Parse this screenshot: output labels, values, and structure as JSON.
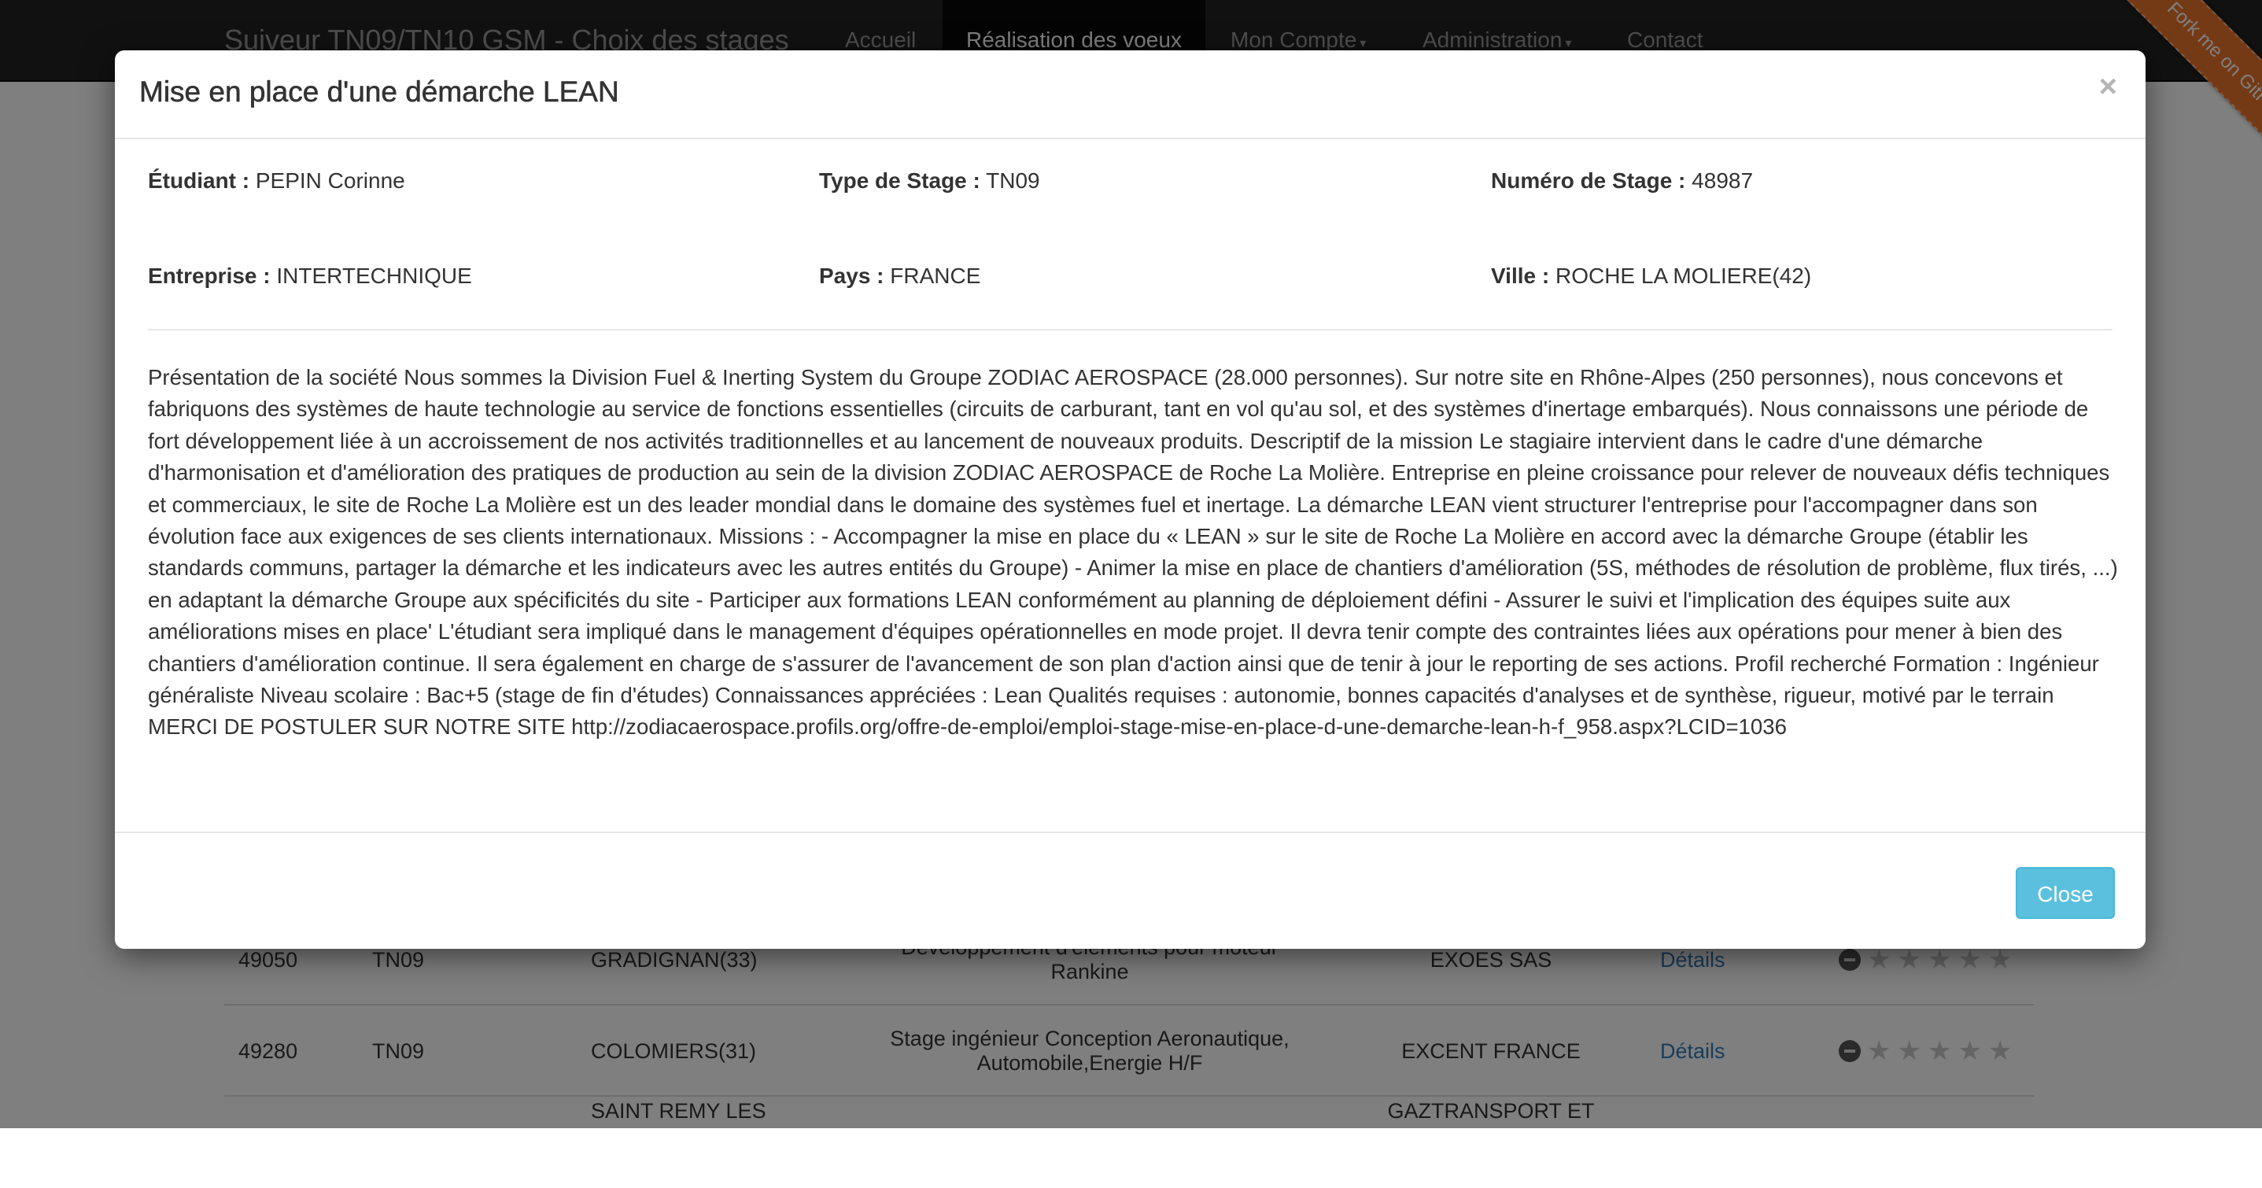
{
  "navbar": {
    "brand": "Suiveur TN09/TN10 GSM - Choix des stages",
    "items": [
      {
        "label": "Accueil"
      },
      {
        "label": "Réalisation des voeux"
      },
      {
        "label": "Mon Compte"
      },
      {
        "label": "Administration"
      },
      {
        "label": "Contact"
      }
    ],
    "ribbon": "Fork me on GitHub"
  },
  "table": {
    "rows": [
      {
        "number": "49050",
        "type": "TN09",
        "city": "GRADIGNAN(33)",
        "title": "Développement d'éléments pour moteur Rankine",
        "company": "EXOES SAS",
        "link": "Détails"
      },
      {
        "number": "49280",
        "type": "TN09",
        "city": "COLOMIERS(31)",
        "title": "Stage ingénieur Conception Aeronautique, Automobile,Energie H/F",
        "company": "EXCENT FRANCE",
        "link": "Détails"
      },
      {
        "number": "",
        "type": "",
        "city": "SAINT REMY LES",
        "title": "",
        "company": "GAZTRANSPORT ET",
        "link": ""
      }
    ]
  },
  "modal": {
    "title": "Mise en place d'une démarche LEAN",
    "close_symbol": "×",
    "fields": {
      "student": {
        "label": "Étudiant :",
        "value": "PEPIN Corinne"
      },
      "type": {
        "label": "Type de Stage :",
        "value": "TN09"
      },
      "number": {
        "label": "Numéro de Stage :",
        "value": "48987"
      },
      "company": {
        "label": "Entreprise :",
        "value": "INTERTECHNIQUE"
      },
      "country": {
        "label": "Pays :",
        "value": "FRANCE"
      },
      "city": {
        "label": "Ville :",
        "value": "ROCHE LA MOLIERE(42)"
      }
    },
    "description": "Présentation de la société Nous sommes la Division Fuel & Inerting System du Groupe ZODIAC AEROSPACE (28.000 personnes). Sur notre site en Rhône-Alpes (250 personnes), nous concevons et fabriquons des systèmes de haute technologie au service de fonctions essentielles (circuits de carburant, tant en vol qu'au sol, et des systèmes d'inertage embarqués). Nous connaissons une période de fort développement liée à un accroissement de nos activités traditionnelles et au lancement de nouveaux produits. Descriptif de la mission Le stagiaire intervient dans le cadre d'une démarche d'harmonisation et d'amélioration des pratiques de production au sein de la division ZODIAC AEROSPACE de Roche La Molière. Entreprise en pleine croissance pour relever de nouveaux défis techniques et commerciaux, le site de Roche La Molière est un des leader mondial dans le domaine des systèmes fuel et inertage. La démarche LEAN vient structurer l'entreprise pour l'accompagner dans son évolution face aux exigences de ses clients internationaux. Missions : - Accompagner la mise en place du « LEAN » sur le site de Roche La Molière en accord avec la démarche Groupe (établir les standards communs, partager la démarche et les indicateurs avec les autres entités du Groupe) - Animer la mise en place de chantiers d'amélioration (5S, méthodes de résolution de problème, flux tirés, ...) en adaptant la démarche Groupe aux spécificités du site - Participer aux formations LEAN conformément au planning de déploiement défini - Assurer le suivi et l'implication des équipes suite aux améliorations mises en place' L'étudiant sera impliqué dans le management d'équipes opérationnelles en mode projet. Il devra tenir compte des contraintes liées aux opérations pour mener à bien des chantiers d'amélioration continue. Il sera également en charge de s'assurer de l'avancement de son plan d'action ainsi que de tenir à jour le reporting de ses actions. Profil recherché Formation : Ingénieur généraliste Niveau scolaire : Bac+5 (stage de fin d'études) Connaissances appréciées : Lean Qualités requises : autonomie, bonnes capacités d'analyses et de synthèse, rigueur, motivé par le terrain MERCI DE POSTULER SUR NOTRE SITE http://zodiacaerospace.profils.org/offre-de-emploi/emploi-stage-mise-en-place-d-une-demarche-lean-h-f_958.aspx?LCID=1036",
    "close_button": "Close"
  },
  "colors": {
    "navbar_bg": "#222222",
    "ribbon": "#e8742a",
    "close_button": "#5bc0de",
    "link": "#337ab7"
  },
  "icons": {
    "modal_close": "close-icon",
    "rating_clear": "minus-circle-icon",
    "rating": "star-icon"
  }
}
